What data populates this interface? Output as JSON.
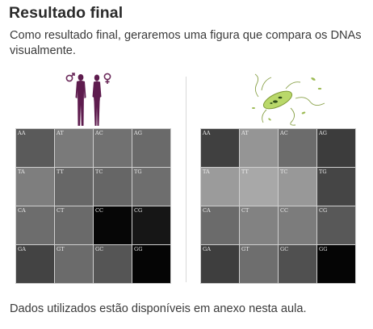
{
  "page": {
    "title": "Resultado final",
    "intro": "Como resultado final, geraremos uma figura que compara os DNAs visualmente.",
    "footer": "Dados utilizados estão disponíveis em anexo nesta aula."
  },
  "figures": [
    {
      "id": "human",
      "icon": "human-couple-illustration",
      "cells": [
        {
          "label": "AA",
          "color": "#5a5a5a"
        },
        {
          "label": "AT",
          "color": "#7a7a7a"
        },
        {
          "label": "AC",
          "color": "#717171"
        },
        {
          "label": "AG",
          "color": "#6a6a6a"
        },
        {
          "label": "TA",
          "color": "#7e7e7e"
        },
        {
          "label": "TT",
          "color": "#676767"
        },
        {
          "label": "TC",
          "color": "#666666"
        },
        {
          "label": "TG",
          "color": "#6e6e6e"
        },
        {
          "label": "CA",
          "color": "#6d6d6d"
        },
        {
          "label": "CT",
          "color": "#6a6a6a"
        },
        {
          "label": "CC",
          "color": "#060606"
        },
        {
          "label": "CG",
          "color": "#161616"
        },
        {
          "label": "GA",
          "color": "#434343"
        },
        {
          "label": "GT",
          "color": "#6b6b6b"
        },
        {
          "label": "GC",
          "color": "#555555"
        },
        {
          "label": "GG",
          "color": "#050505"
        }
      ]
    },
    {
      "id": "bacteria",
      "icon": "bacterium-illustration",
      "cells": [
        {
          "label": "AA",
          "color": "#404040"
        },
        {
          "label": "AT",
          "color": "#959595"
        },
        {
          "label": "AC",
          "color": "#6c6c6c"
        },
        {
          "label": "AG",
          "color": "#3c3c3c"
        },
        {
          "label": "TA",
          "color": "#9b9b9b"
        },
        {
          "label": "TT",
          "color": "#a8a8a8"
        },
        {
          "label": "TC",
          "color": "#989898"
        },
        {
          "label": "TG",
          "color": "#454545"
        },
        {
          "label": "CA",
          "color": "#6b6b6b"
        },
        {
          "label": "CT",
          "color": "#828282"
        },
        {
          "label": "CC",
          "color": "#7c7c7c"
        },
        {
          "label": "CG",
          "color": "#585858"
        },
        {
          "label": "GA",
          "color": "#3e3e3e"
        },
        {
          "label": "GT",
          "color": "#6e6e6e"
        },
        {
          "label": "GC",
          "color": "#505050"
        },
        {
          "label": "GG",
          "color": "#050505"
        }
      ]
    }
  ]
}
